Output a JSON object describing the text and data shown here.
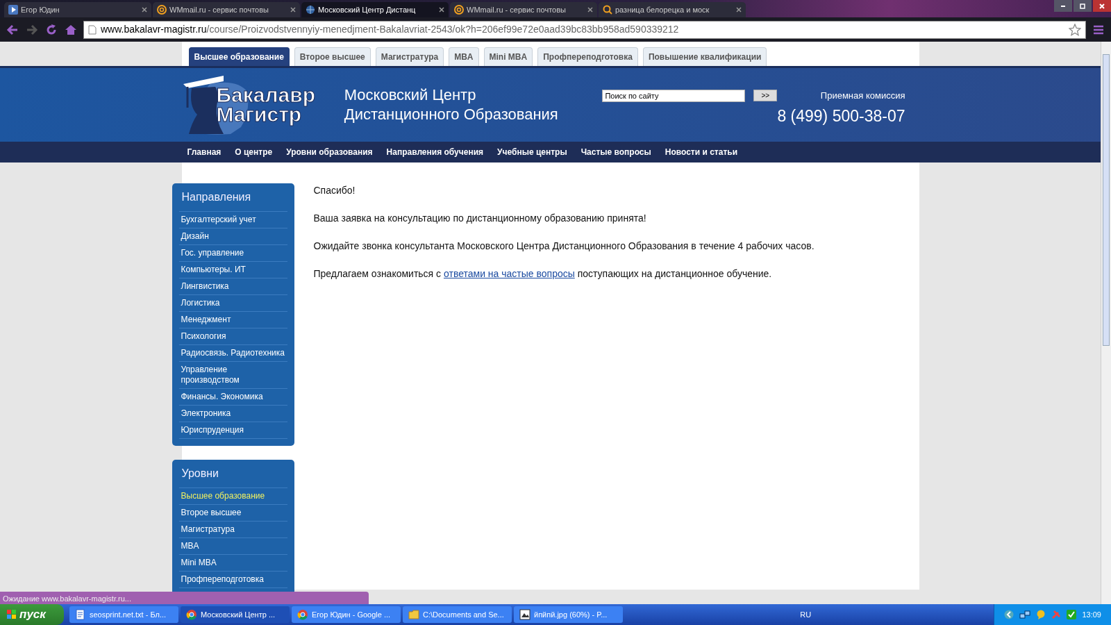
{
  "browser": {
    "tabs": [
      {
        "title": "Егор Юдин",
        "selected": false,
        "kind": "video"
      },
      {
        "title": "WMmail.ru - сервис почтовы",
        "selected": false,
        "kind": "mail"
      },
      {
        "title": "Московский Центр Дистанц",
        "selected": true,
        "kind": "site"
      },
      {
        "title": "WMmail.ru - сервис почтовы",
        "selected": false,
        "kind": "mail"
      },
      {
        "title": "разница белорецка и моск",
        "selected": false,
        "kind": "search"
      }
    ],
    "address": {
      "domain": "www.bakalavr-magistr.ru",
      "path": "/course/Proizvodstvennyiy-menedjment-Bakalavriat-2543/ok?h=206ef99e72e0aad39bc83bb958ad590339212"
    }
  },
  "site": {
    "level_tabs": [
      {
        "label": "Высшее образование",
        "selected": true
      },
      {
        "label": "Второе высшее",
        "selected": false
      },
      {
        "label": "Магистратура",
        "selected": false
      },
      {
        "label": "MBA",
        "selected": false
      },
      {
        "label": "Mini MBA",
        "selected": false
      },
      {
        "label": "Профпереподготовка",
        "selected": false
      },
      {
        "label": "Повышение квалификации",
        "selected": false
      }
    ],
    "logo": [
      "Бакалавр",
      "Магистр"
    ],
    "title": [
      "Московский Центр",
      "Дистанционного Образования"
    ],
    "search": {
      "placeholder": "Поиск по сайту",
      "button": ">>"
    },
    "admissions": {
      "label": "Приемная комиссия",
      "phone": "8 (499) 500-38-07"
    },
    "nav": [
      "Главная",
      "О центре",
      "Уровни образования",
      "Направления обучения",
      "Учебные центры",
      "Частые вопросы",
      "Новости и статьи"
    ],
    "sidebar": [
      {
        "title": "Направления",
        "items": [
          {
            "label": "Бухгалтерский учет",
            "selected": false
          },
          {
            "label": "Дизайн",
            "selected": false
          },
          {
            "label": "Гос. управление",
            "selected": false
          },
          {
            "label": "Компьютеры. ИТ",
            "selected": false
          },
          {
            "label": "Лингвистика",
            "selected": false
          },
          {
            "label": "Логистика",
            "selected": false
          },
          {
            "label": "Менеджмент",
            "selected": false
          },
          {
            "label": "Психология",
            "selected": false
          },
          {
            "label": "Радиосвязь. Радиотехника",
            "selected": false
          },
          {
            "label": "Управление производством",
            "selected": false
          },
          {
            "label": "Финансы. Экономика",
            "selected": false
          },
          {
            "label": "Электроника",
            "selected": false
          },
          {
            "label": "Юриспруденция",
            "selected": false
          }
        ]
      },
      {
        "title": "Уровни",
        "items": [
          {
            "label": "Высшее образование",
            "selected": true
          },
          {
            "label": "Второе высшее",
            "selected": false
          },
          {
            "label": "Магистратура",
            "selected": false
          },
          {
            "label": "MBA",
            "selected": false
          },
          {
            "label": "Mini MBA",
            "selected": false
          },
          {
            "label": "Профпереподготовка",
            "selected": false
          }
        ]
      }
    ],
    "paragraphs": [
      {
        "text": "Спасибо!"
      },
      {
        "text": "Ваша заявка на консультацию по дистанционному образованию принята!"
      },
      {
        "text": "Ожидайте звонка консультанта Московского Центра Дистанционного Образования в течение 4 рабочих часов."
      },
      {
        "text": "Предлагаем ознакомиться с",
        "link": "ответами на частые вопросы",
        "after": "поступающих на дистанционное обучение."
      }
    ]
  },
  "status_bubble": "Ожидание www.bakalavr-magistr.ru...",
  "taskbar": {
    "start": "пуск",
    "tasks": [
      {
        "label": "seosprint.net.txt - Бл...",
        "selected": false,
        "kind": "notepad"
      },
      {
        "label": "Московский Центр ...",
        "selected": true,
        "kind": "chrome"
      },
      {
        "label": "Егор Юдин - Google ...",
        "selected": false,
        "kind": "chrome"
      },
      {
        "label": "C:\\Documents and Se...",
        "selected": false,
        "kind": "folder"
      },
      {
        "label": "йпйпй.jpg (60%) - P...",
        "selected": false,
        "kind": "image"
      }
    ],
    "lang": "RU",
    "clock": "13:09"
  }
}
